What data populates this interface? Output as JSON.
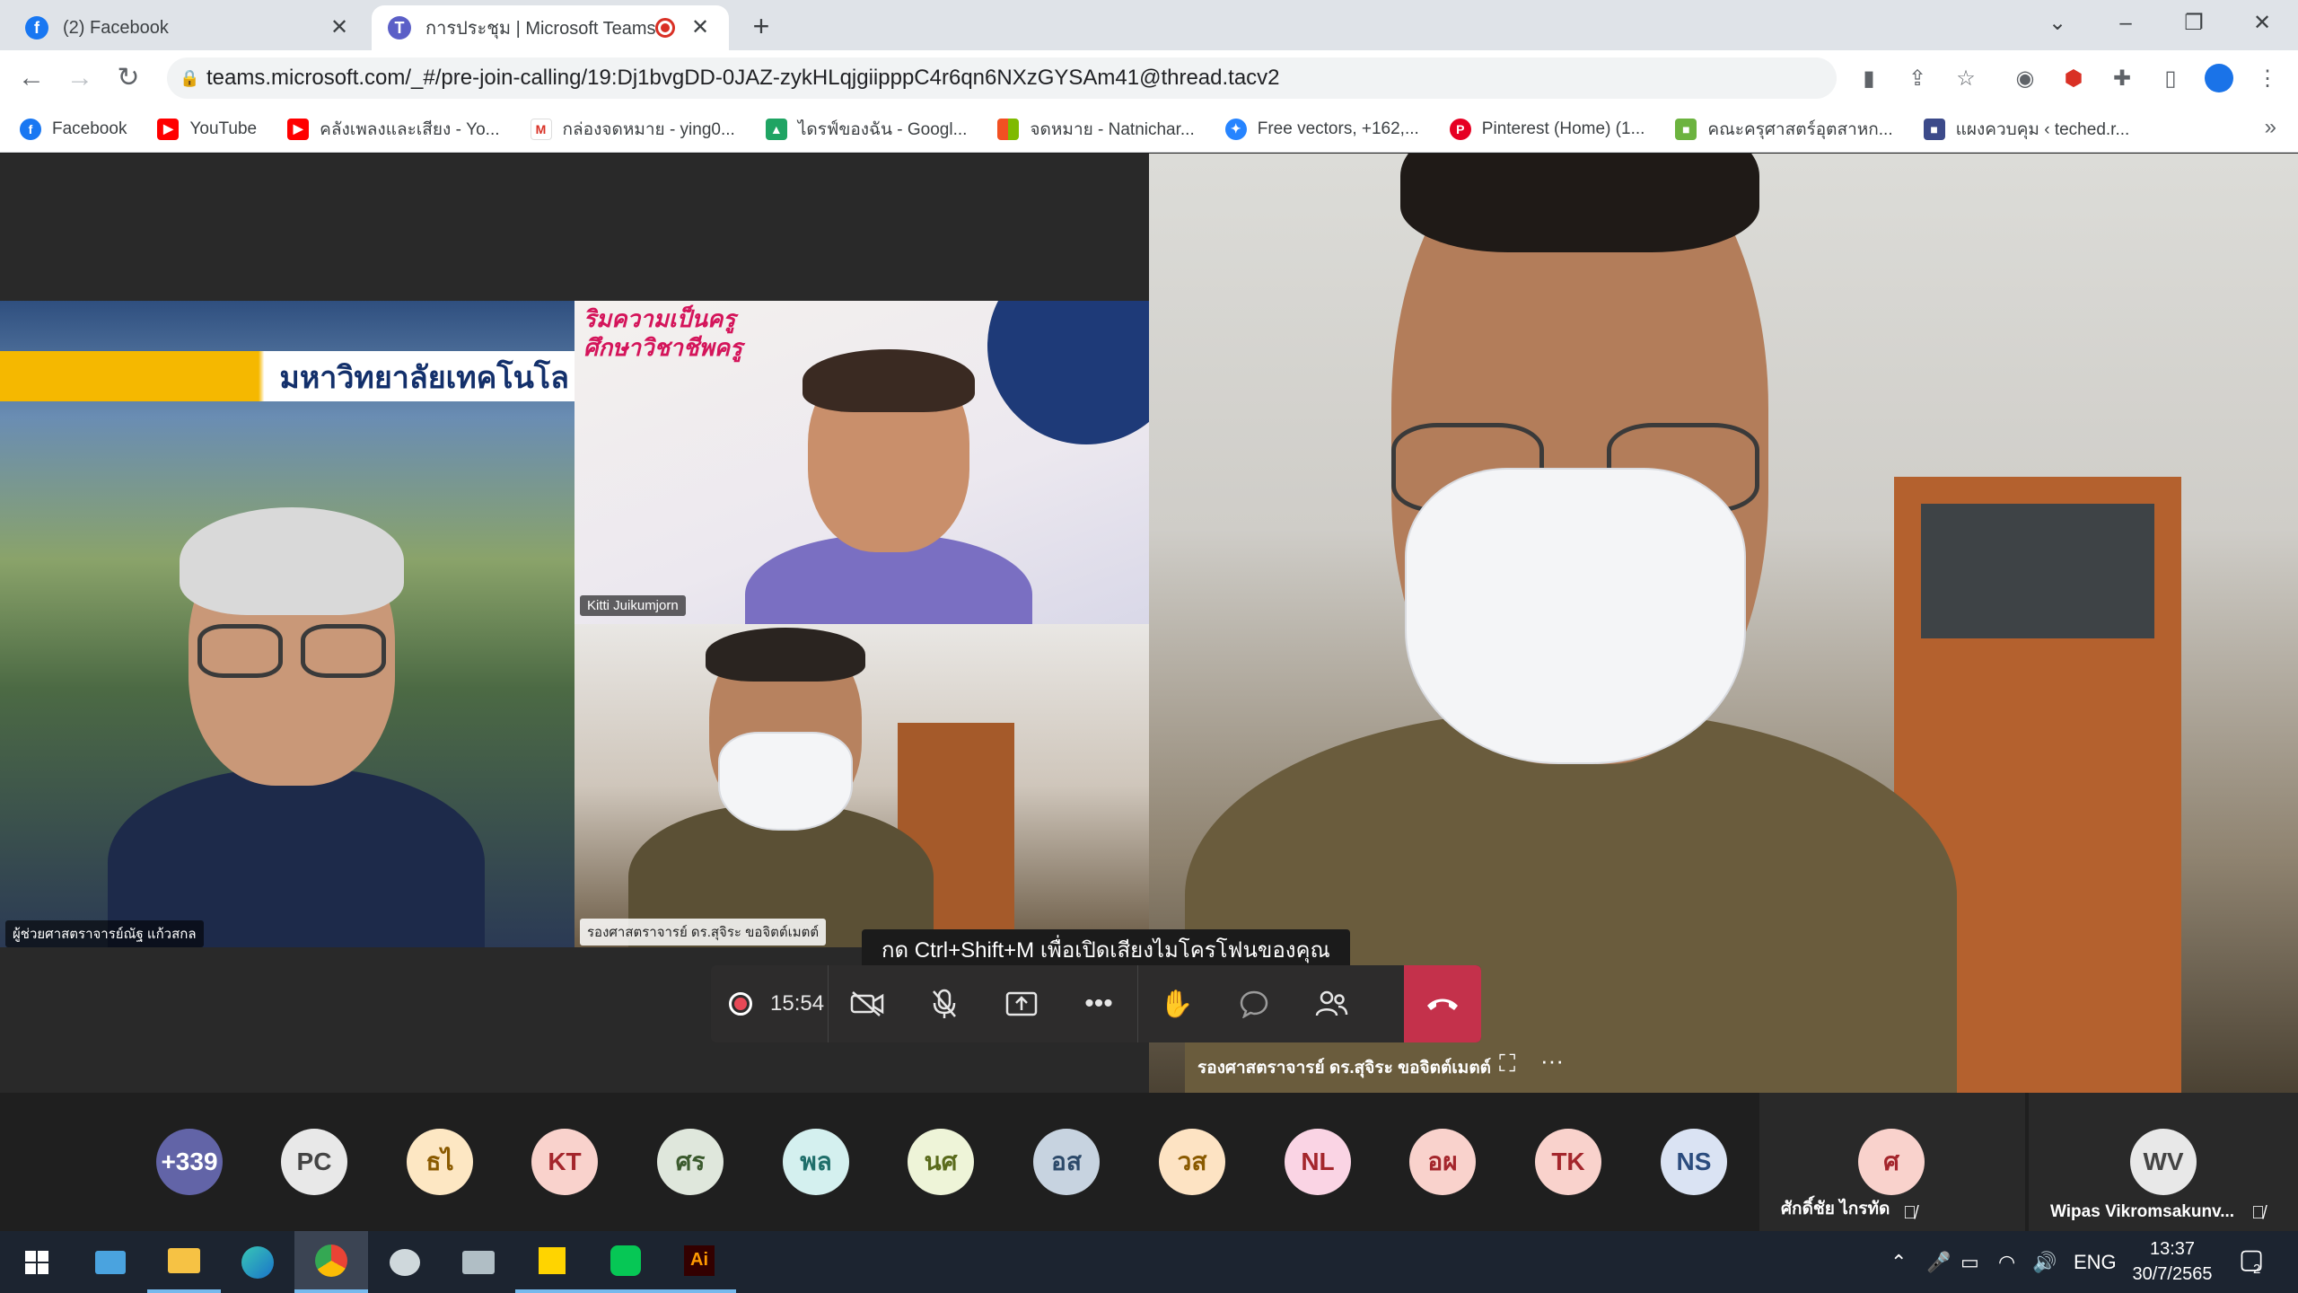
{
  "browser": {
    "tabs": [
      {
        "label": "(2) Facebook",
        "active": false
      },
      {
        "label": "การประชุม | Microsoft Teams",
        "active": true
      }
    ],
    "url": "teams.microsoft.com/_#/pre-join-calling/19:Dj1bvgDD-0JAZ-zykHLqjgiipppC4r6qn6NXzGYSAm41@thread.tacv2",
    "bookmarks": [
      {
        "label": "Facebook",
        "icon": "facebook-icon",
        "color": "#1877f2"
      },
      {
        "label": "YouTube",
        "icon": "youtube-icon",
        "color": "#ff0000"
      },
      {
        "label": "คลังเพลงและเสียง - Yo...",
        "icon": "youtube-icon",
        "color": "#ff0000"
      },
      {
        "label": "กล่องจดหมาย - ying0...",
        "icon": "gmail-icon",
        "color": "#d93025"
      },
      {
        "label": "ไดรฟ์ของฉัน - Googl...",
        "icon": "drive-icon",
        "color": "#1fa463"
      },
      {
        "label": "จดหมาย - Natnichar...",
        "icon": "microsoft-icon",
        "color": "#f25022"
      },
      {
        "label": "Free vectors, +162,...",
        "icon": "vector-icon",
        "color": "#2684ff"
      },
      {
        "label": "Pinterest (Home) (1...",
        "icon": "pinterest-icon",
        "color": "#e60023"
      },
      {
        "label": "คณะครุศาสตร์อุตสาหก...",
        "icon": "faculty-icon",
        "color": "#6cb33f"
      },
      {
        "label": "แผงควบคุม ‹ teched.r...",
        "icon": "dashboard-icon",
        "color": "#3c4a8a"
      }
    ]
  },
  "meeting": {
    "videos": {
      "left_name": "ผู้ช่วยศาสตราจารย์ณัฐ แก้วสกล",
      "left_banner": "มหาวิทยาลัยเทคโนโล",
      "topmid_name": "Kitti Juikumjorn",
      "topmid_slogan": "ริมความเป็นครู\nศึกษาวิชาชีพครู",
      "botmid_name": "รองศาสตราจารย์ ดร.สุจิระ ขอจิตต์เมตต์",
      "right_name": "รองศาสตราจารย์ ดร.สุจิระ ขอจิตต์เมตต์"
    },
    "tooltip": "กด Ctrl+Shift+M เพื่อเปิดเสียงไมโครโฟนของคุณ",
    "timer": "15:54",
    "participants": [
      {
        "initials": "+339",
        "bg": "#6264a7",
        "fg": "#ffffff"
      },
      {
        "initials": "PC",
        "bg": "#e8e8e8",
        "fg": "#444444"
      },
      {
        "initials": "ธไ",
        "bg": "#fde7c3",
        "fg": "#8a5a00"
      },
      {
        "initials": "KT",
        "bg": "#f9d2cc",
        "fg": "#a4262c"
      },
      {
        "initials": "ศร",
        "bg": "#dfe7dc",
        "fg": "#3b5a2e"
      },
      {
        "initials": "พล",
        "bg": "#d4f0ef",
        "fg": "#1f6f6b"
      },
      {
        "initials": "นศ",
        "bg": "#eef4d8",
        "fg": "#5a6b1c"
      },
      {
        "initials": "อส",
        "bg": "#c7d3e0",
        "fg": "#2d4a6a"
      },
      {
        "initials": "วส",
        "bg": "#fde3c3",
        "fg": "#8a5a00"
      },
      {
        "initials": "NL",
        "bg": "#fad4e4",
        "fg": "#a4262c"
      },
      {
        "initials": "อผ",
        "bg": "#f9d2cc",
        "fg": "#a4262c"
      },
      {
        "initials": "TK",
        "bg": "#f9d2cc",
        "fg": "#a4262c"
      },
      {
        "initials": "NS",
        "bg": "#dae3f3",
        "fg": "#2b4c7e"
      }
    ],
    "named_tiles": [
      {
        "initials": "ศ",
        "name": "ศักดิ์ชัย ไกรทัด",
        "bg": "#f9d2cc",
        "fg": "#a4262c"
      },
      {
        "initials": "WV",
        "name": "Wipas Vikromsakunv...",
        "bg": "#e8e8e8",
        "fg": "#444444"
      }
    ]
  },
  "taskbar": {
    "lang": "ENG",
    "time": "13:37",
    "date": "30/7/2565",
    "notifications": "2"
  }
}
